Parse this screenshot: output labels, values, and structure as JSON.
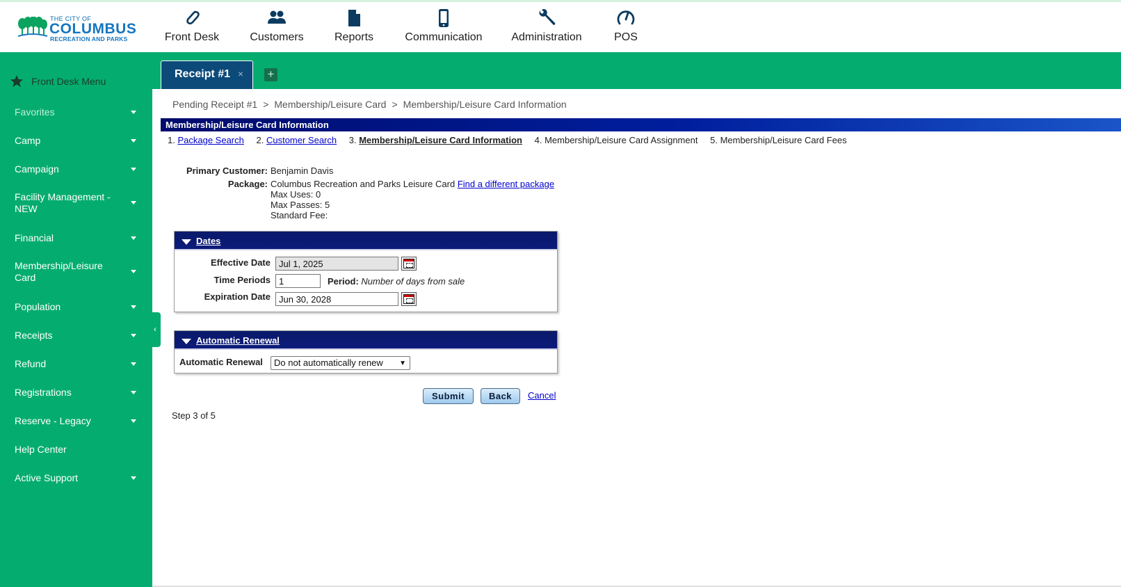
{
  "header": {
    "logo": {
      "small": "THE CITY OF",
      "big": "COLUMBUS",
      "sub": "RECREATION AND PARKS"
    },
    "nav": [
      {
        "label": "Front Desk",
        "icon": "paperclip-icon"
      },
      {
        "label": "Customers",
        "icon": "users-icon"
      },
      {
        "label": "Reports",
        "icon": "document-icon"
      },
      {
        "label": "Communication",
        "icon": "phone-icon"
      },
      {
        "label": "Administration",
        "icon": "wrench-icon"
      },
      {
        "label": "POS",
        "icon": "gauge-icon"
      }
    ]
  },
  "sidebar": {
    "menu_title": "Front Desk Menu",
    "items": [
      {
        "label": "Favorites"
      },
      {
        "label": "Camp"
      },
      {
        "label": "Campaign"
      },
      {
        "label": "Facility Management - NEW"
      },
      {
        "label": "Financial"
      },
      {
        "label": "Membership/Leisure Card"
      },
      {
        "label": "Population"
      },
      {
        "label": "Receipts"
      },
      {
        "label": "Refund"
      },
      {
        "label": "Registrations"
      },
      {
        "label": "Reserve - Legacy"
      },
      {
        "label": "Help Center"
      },
      {
        "label": "Active Support"
      }
    ]
  },
  "tabs": {
    "active_label": "Receipt #1",
    "close_glyph": "×",
    "add_glyph": "+"
  },
  "breadcrumb": {
    "items": [
      "Pending Receipt #1",
      "Membership/Leisure Card",
      "Membership/Leisure Card Information"
    ],
    "separator": ">"
  },
  "page": {
    "title": "Membership/Leisure Card Information",
    "steps": [
      {
        "num": "1.",
        "label": "Package Search"
      },
      {
        "num": "2.",
        "label": "Customer Search"
      },
      {
        "num": "3.",
        "label": "Membership/Leisure Card Information"
      },
      {
        "num": "4.",
        "label": "Membership/Leisure Card Assignment"
      },
      {
        "num": "5.",
        "label": "Membership/Leisure Card Fees"
      }
    ],
    "info": {
      "primary_customer_label": "Primary Customer:",
      "primary_customer_value": "Benjamin Davis",
      "package_label": "Package:",
      "package_value": "Columbus Recreation and Parks Leisure Card",
      "package_link": "Find a different package",
      "max_uses": "Max Uses: 0",
      "max_passes": "Max Passes: 5",
      "standard_fee": "Standard Fee:"
    },
    "dates_panel": {
      "title": "Dates",
      "effective_label": "Effective Date",
      "effective_value": "Jul 1, 2025",
      "time_periods_label": "Time Periods",
      "time_periods_value": "1",
      "period_label": "Period:",
      "period_value": "Number of days from sale",
      "expiration_label": "Expiration Date",
      "expiration_value": "Jun 30, 2028"
    },
    "renewal_panel": {
      "title": "Automatic Renewal",
      "label": "Automatic Renewal",
      "selected": "Do not automatically renew"
    },
    "actions": {
      "submit": "Submit",
      "back": "Back",
      "cancel": "Cancel"
    },
    "step_of": "Step 3 of 5"
  },
  "colors": {
    "sidebar_bg": "#04ad6f",
    "tab_bg": "#0c4a7a",
    "panel_head": "#0b1b7a",
    "link": "#0000cc"
  }
}
